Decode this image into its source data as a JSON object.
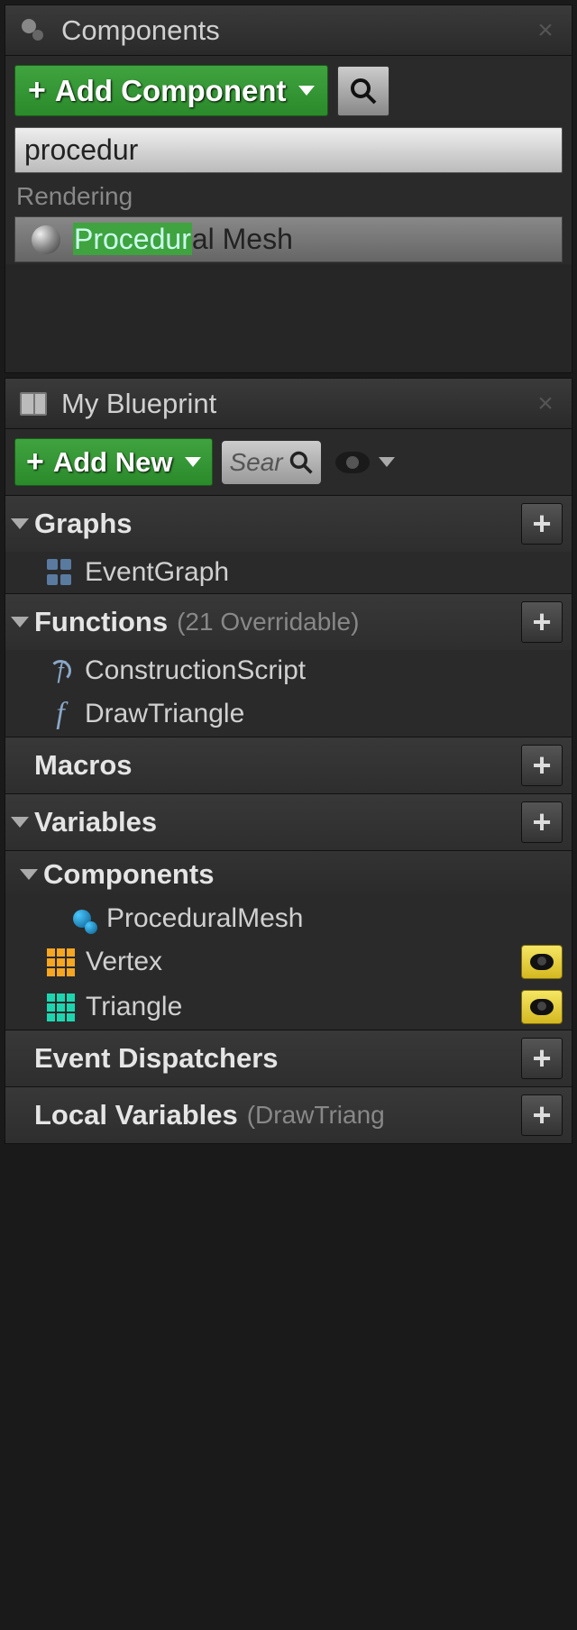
{
  "components_panel": {
    "title": "Components",
    "add_button": "Add Component",
    "search_value": "procedur",
    "category": "Rendering",
    "result_hl": "Procedur",
    "result_rest": "al Mesh"
  },
  "blueprint_panel": {
    "title": "My Blueprint",
    "add_button": "Add New",
    "search_placeholder": "Sear",
    "sections": {
      "graphs": {
        "title": "Graphs"
      },
      "functions": {
        "title": "Functions",
        "sub": "(21 Overridable)"
      },
      "macros": {
        "title": "Macros"
      },
      "variables": {
        "title": "Variables"
      },
      "components": {
        "title": "Components"
      },
      "event_dispatchers": {
        "title": "Event Dispatchers"
      },
      "local_variables": {
        "title": "Local Variables",
        "sub": "(DrawTriang"
      }
    },
    "items": {
      "event_graph": "EventGraph",
      "construction_script": "ConstructionScript",
      "draw_triangle": "DrawTriangle",
      "procedural_mesh": "ProceduralMesh",
      "vertex": "Vertex",
      "triangle": "Triangle"
    }
  }
}
